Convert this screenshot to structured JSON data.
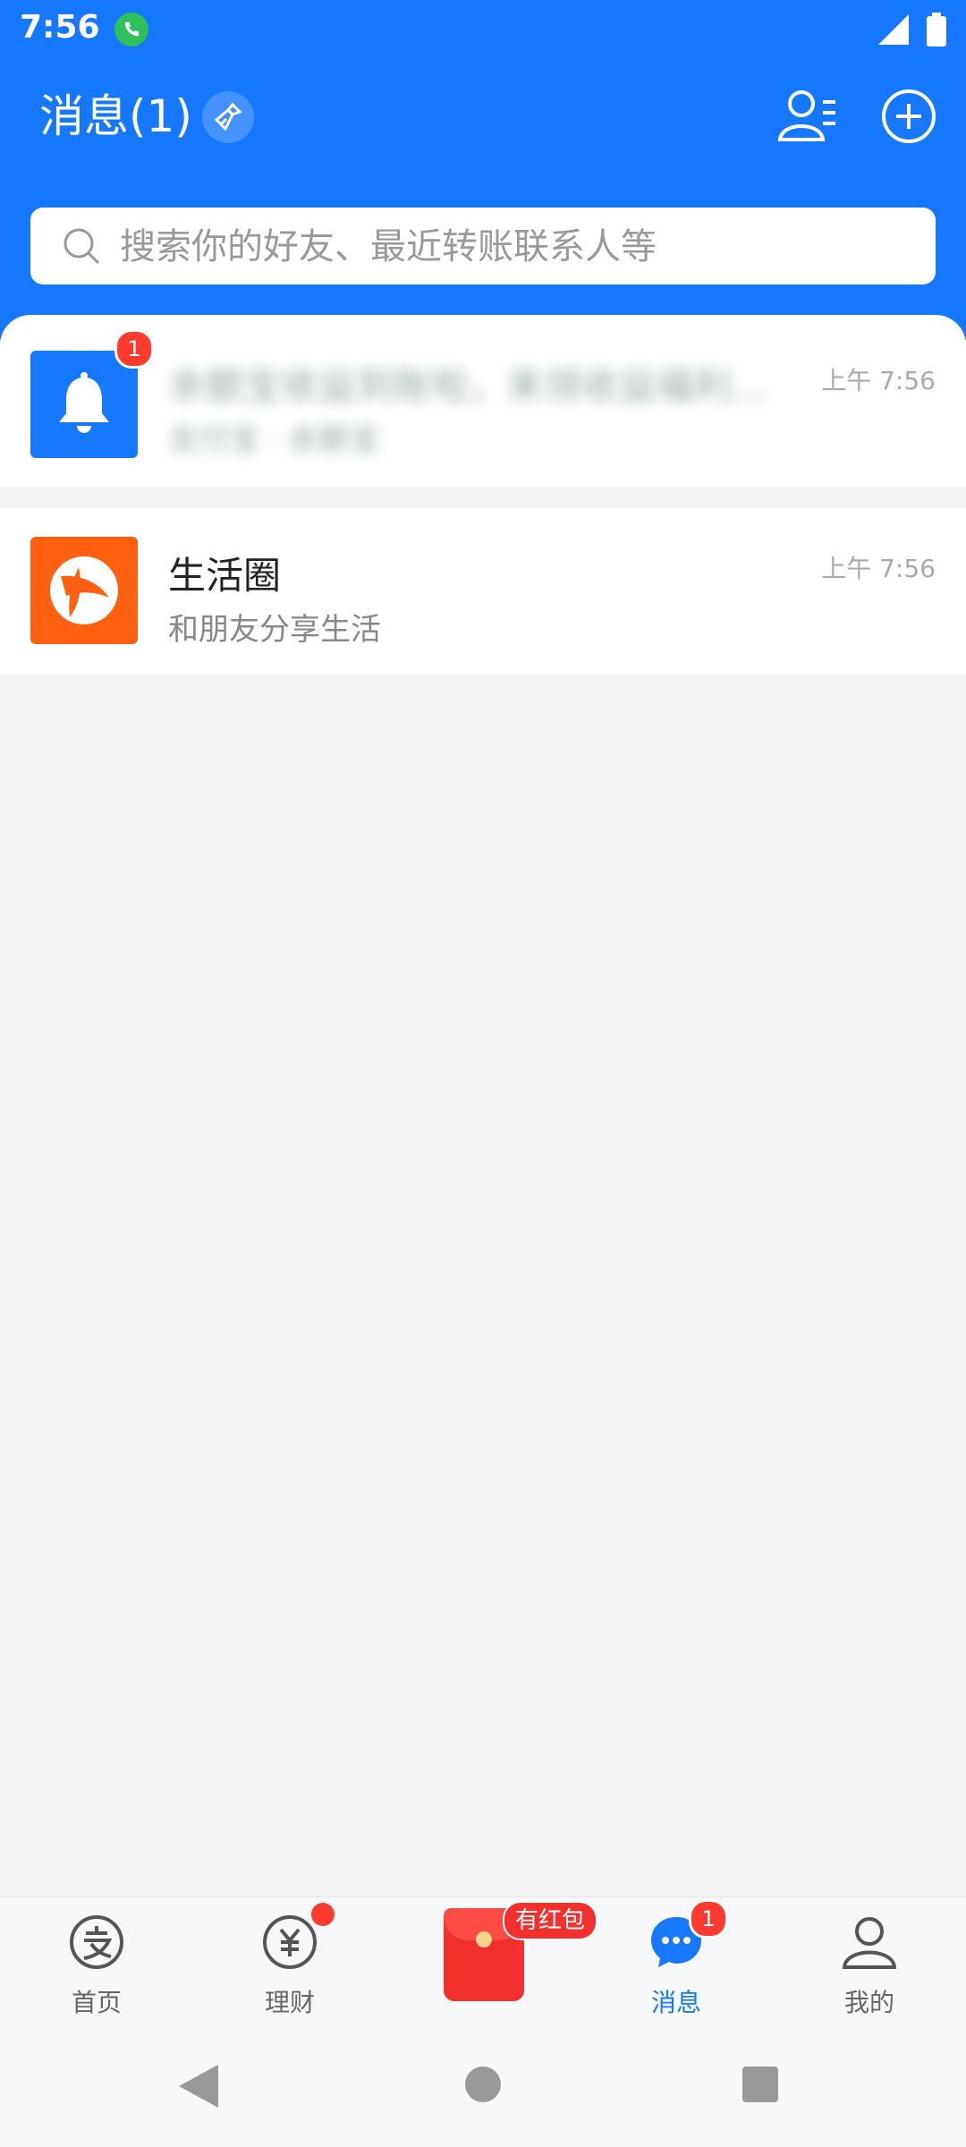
{
  "status_bar": {
    "time": "7:56"
  },
  "header": {
    "title": "消息(1)",
    "search_placeholder": "搜索你的好友、最近转账联系人等"
  },
  "messages": [
    {
      "title": "余额宝收益到账啦，来领收益福利...",
      "subtitle": "支付宝 · 余额宝",
      "time": "上午 7:56",
      "badge": "1",
      "blurred": true
    },
    {
      "title": "生活圈",
      "subtitle": "和朋友分享生活",
      "time": "上午 7:56"
    }
  ],
  "tab_bar": {
    "home": "首页",
    "wealth": "理财",
    "red_packet_tag": "有红包",
    "message": "消息",
    "message_badge": "1",
    "mine": "我的"
  },
  "colors": {
    "brand_blue": "#1677ff",
    "badge_red": "#ff3b30",
    "life_orange": "#ff6010"
  }
}
